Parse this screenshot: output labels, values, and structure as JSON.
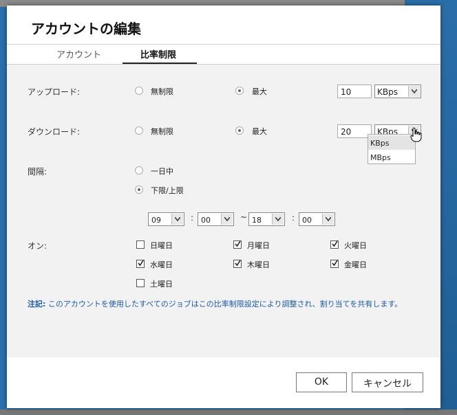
{
  "dialog": {
    "title": "アカウントの編集"
  },
  "tabs": [
    {
      "label": "アカウント"
    },
    {
      "label": "比率制限"
    }
  ],
  "upload": {
    "label": "アップロード:",
    "unlimited": "無制限",
    "max": "最大",
    "selected": "max",
    "value": "10",
    "unit": "KBps"
  },
  "download": {
    "label": "ダウンロード:",
    "unlimited": "無制限",
    "max": "最大",
    "selected": "max",
    "value": "20",
    "unit": "KBps",
    "unit_options": [
      "KBps",
      "MBps"
    ]
  },
  "interval": {
    "label": "間隔:",
    "all_day": "一日中",
    "range": "下限/上限",
    "selected": "range",
    "start_hour": "09",
    "start_min": "00",
    "end_hour": "18",
    "end_min": "00",
    "colon": ":",
    "tilde": "~"
  },
  "on": {
    "label": "オン:",
    "days": [
      {
        "label": "日曜日",
        "checked": false
      },
      {
        "label": "月曜日",
        "checked": true
      },
      {
        "label": "火曜日",
        "checked": true
      },
      {
        "label": "水曜日",
        "checked": true
      },
      {
        "label": "木曜日",
        "checked": true
      },
      {
        "label": "金曜日",
        "checked": true
      },
      {
        "label": "土曜日",
        "checked": false
      }
    ]
  },
  "note": {
    "prefix": "注記:",
    "text": "このアカウントを使用したすべてのジョブはこの比率制限設定により調整され、割り当てを共有します。"
  },
  "buttons": {
    "ok": "OK",
    "cancel": "キャンセル"
  },
  "colors": {
    "note": "#1a5aa8",
    "desktop": "#2d6fa8"
  }
}
